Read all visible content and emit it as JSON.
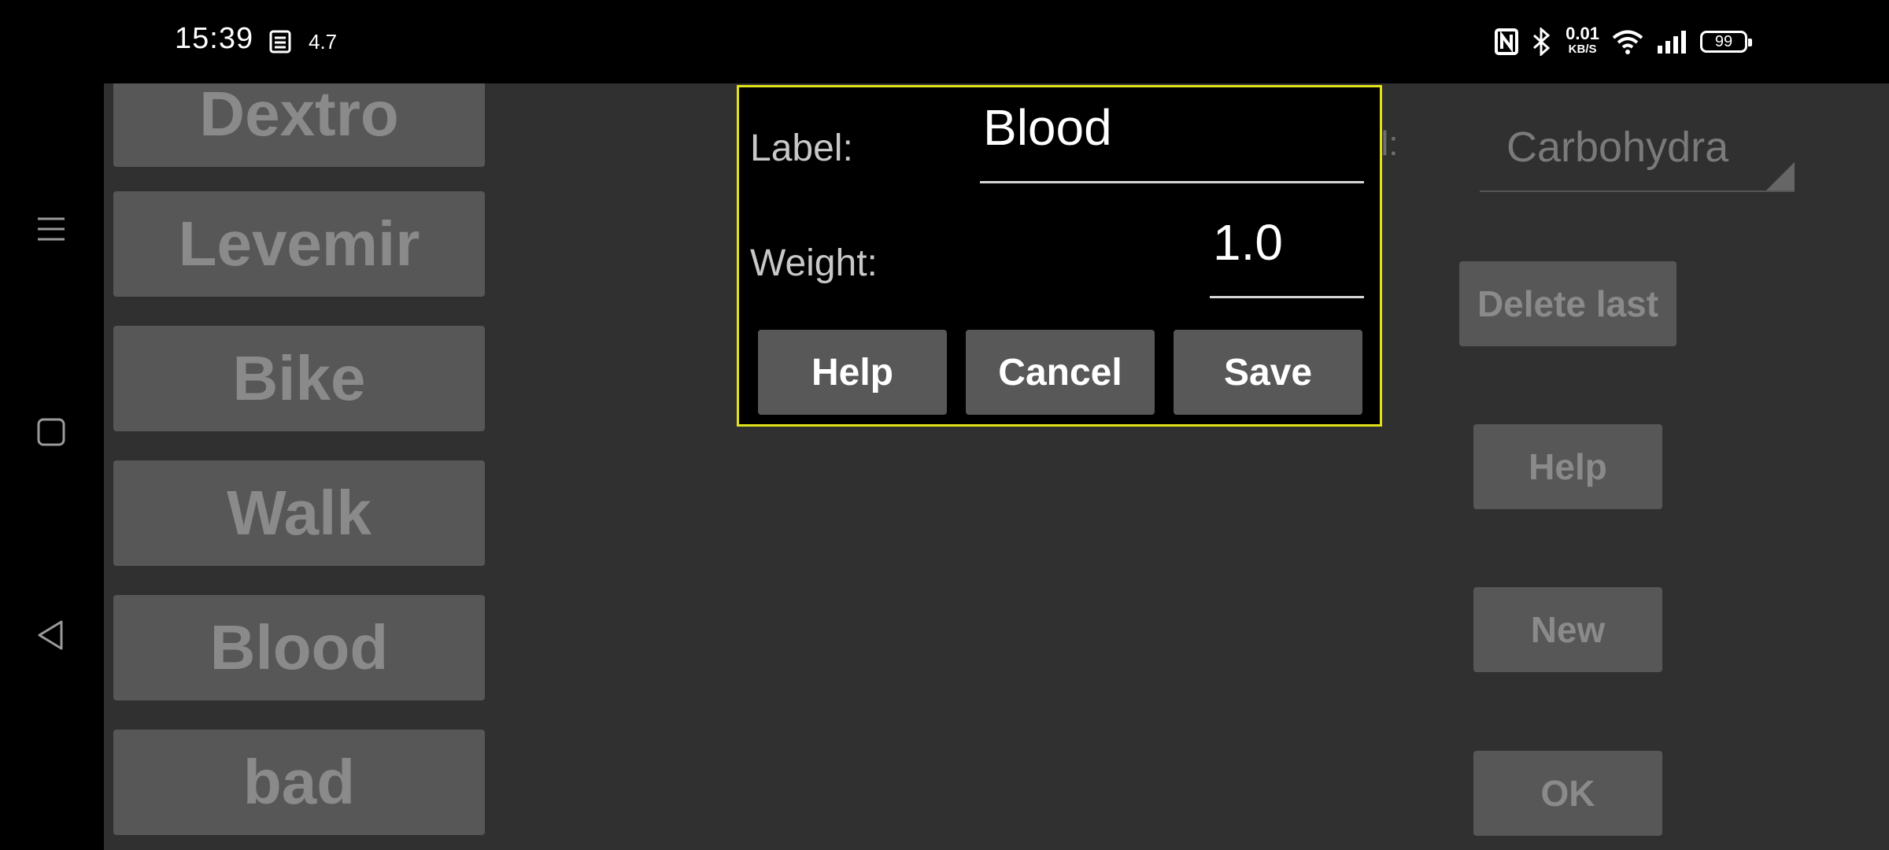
{
  "status_bar": {
    "time": "15:39",
    "speed_value": "4.7",
    "net_speed_value": "0.01",
    "net_speed_unit": "KB/S",
    "battery": "99",
    "icons": [
      "message-icon",
      "nfc-icon",
      "bluetooth-icon",
      "wifi-icon",
      "signal-icon",
      "battery-icon"
    ]
  },
  "nav": {
    "icons": [
      "menu-icon",
      "home-square-icon",
      "back-triangle-icon"
    ]
  },
  "background": {
    "left_buttons": [
      "Dextro",
      "Levemir",
      "Bike",
      "Walk",
      "Blood",
      "bad"
    ],
    "label_fragment": "al:",
    "spinner_value": "Carbohydra",
    "delete_last": "Delete last",
    "help": "Help",
    "new": "New",
    "ok": "OK"
  },
  "dialog": {
    "label_caption": "Label:",
    "label_value": "Blood",
    "weight_caption": "Weight:",
    "weight_value": "1.0",
    "help_button": "Help",
    "cancel_button": "Cancel",
    "save_button": "Save"
  },
  "colors": {
    "dialog_border": "#e2e21a",
    "app_background": "#303030",
    "button_background": "#575757"
  }
}
